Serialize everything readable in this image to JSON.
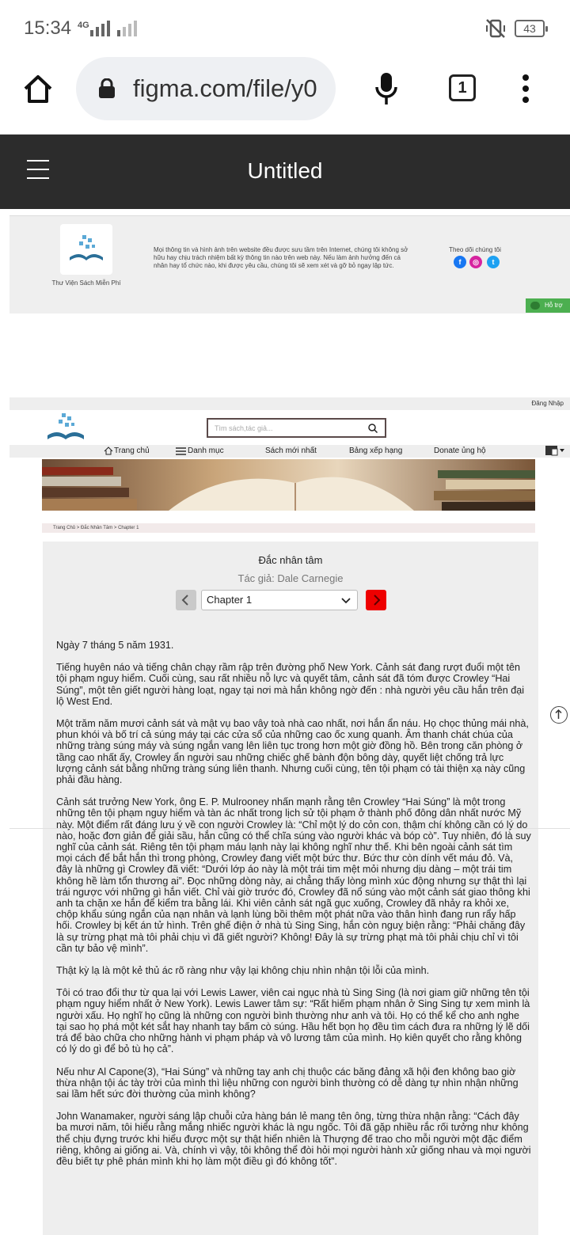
{
  "status_bar": {
    "time": "15:34",
    "network": "4G",
    "battery": "43"
  },
  "browser": {
    "url": "figma.com/file/y0",
    "tab_count": "1",
    "icons": [
      "home-icon",
      "lock-icon",
      "mic-icon",
      "tabs-icon",
      "more-vert-icon"
    ]
  },
  "figma": {
    "title": "Untitled"
  },
  "footer": {
    "site_name": "Thư Viện Sách Miễn Phí",
    "disclaimer": "Mọi thông tin và hình ảnh trên website đều được sưu tầm trên Internet, chúng tôi không sở hữu hay chịu trách nhiệm bất kỳ thông tin nào trên web này. Nếu làm ảnh hưởng đến cá nhân hay tổ chức nào, khi được yêu cầu, chúng tôi sẽ xem xét và gỡ bỏ ngay lập tức.",
    "follow_label": "Theo dõi chúng tôi",
    "support_label": "Hỗ trợ",
    "social_colors": {
      "facebook": "#1877f2",
      "instagram": "#d6249f",
      "twitter": "#1da1f2"
    }
  },
  "site": {
    "login": "Đăng Nhập",
    "search_placeholder": "Tìm sách,tác giả...",
    "nav": {
      "home": "Trang chủ",
      "catalog": "Danh mục",
      "new": "Sách mới nhất",
      "ranking": "Bảng xếp hạng",
      "donate": "Donate ủng hộ"
    },
    "breadcrumb": [
      "Trang Chủ",
      "Đắc Nhân Tâm",
      "Chapter 1"
    ]
  },
  "reader": {
    "book_title": "Đắc nhân tâm",
    "author": "Tác giả: Dale Carnegie",
    "chapter": "Chapter 1",
    "next_color": "#ee0000",
    "paragraphs": [
      "Ngày 7 tháng 5 năm 1931.",
      "Tiếng huyên náo và tiếng chân chạy rầm rập trên đường phố New York. Cảnh sát đang rượt đuổi một tên tội phạm nguy hiểm. Cuối cùng, sau rất nhiều nỗ lực và quyết tâm, cảnh sát đã tóm được Crowley “Hai Súng”, một tên giết người hàng loạt, ngay tại nơi mà hắn không ngờ đến : nhà người yêu cầu hắn trên đại lộ West End.",
      "Một trăm năm mươi cảnh sát và mật vụ bao vây toà nhà cao nhất, nơi hắn ẩn náu. Họ chọc thủng mái nhà, phun khói và bố trí cả súng máy tại các cửa sổ của những cao ốc xung quanh. Âm thanh chát chúa của những tràng súng máy và súng ngắn vang lên liên tục trong hơn một giờ đồng hồ. Bên trong căn phòng ở tầng cao nhất ấy, Crowley ẩn người sau những chiếc ghế bành độn bông dày, quyết liệt chống trả lực lượng cảnh sát bằng những tràng súng liên thanh. Nhưng cuối cùng, tên tội phạm có tài thiện xạ này cũng phải đầu hàng.",
      "Cảnh sát trưởng New York, ông E. P. Mulrooney nhấn mạnh rằng tên Crowley “Hai Súng” là một trong những tên tội phạm nguy hiểm và tàn ác nhất trong lịch sử tội phạm ở thành phố đông dân nhất nước Mỹ này. Một điểm rất đáng lưu ý về con người Crowley là: “Chỉ một lý do cỏn con, thậm chí không cần có lý do nào, hoặc đơn giản để giải sầu, hắn cũng có thể chĩa súng vào người khác và bóp cò”. Tuy nhiên, đó là suy nghĩ của cảnh sát. Riêng tên tội phạm máu lạnh này lại không nghĩ như thế. Khi bên ngoài cảnh sát tìm mọi cách để bắt hắn thì trong phòng, Crowley đang viết một bức thư. Bức thư còn dính vết máu đỏ. Và, đây là những gì Crowley đã viết: “Dưới lớp áo này là một trái tim mệt mỏi nhưng dịu dàng – một trái tim không hề làm tổn thương ai”. Đọc những dòng này, ai chẳng thấy lòng mình xúc động nhưng sự thật thì lại trái ngược với những gì hắn viết. Chỉ vài giờ trước đó, Crowley đã nổ súng vào một cảnh sát giao thông khi anh ta chặn xe hắn để kiểm tra bằng lái. Khi viên cảnh sát ngã gục xuống, Crowley đã nhảy ra khỏi xe, chộp khẩu súng ngắn của nạn nhân và lạnh lùng bồi thêm một phát nữa vào thân hình đang run rẩy hấp hối. Crowley bị kết án tử hình. Trên ghế điện ở nhà tù Sing Sing, hắn còn nguỵ biện rằng: “Phải chăng đây là sự trừng phạt mà tôi phải chịu vì đã giết người? Không! Đây là sự trừng phạt mà tôi phải chịu chỉ vì tôi cần tự bảo vệ mình”.",
      "Thật kỳ lạ là một kẻ thủ ác rõ ràng như vậy lại không chịu nhìn nhận tội lỗi của mình.",
      "Tôi có trao đổi thư từ qua lại với Lewis Lawer, viên cai ngục nhà tù Sing Sing (là nơi giam giữ những tên tội phạm nguy hiểm nhất ở New York). Lewis Lawer tâm sự: “Rất hiếm phạm nhân ở Sing Sing tự xem mình là người xấu. Họ nghĩ họ cũng là những con người bình thường như anh và tôi. Họ có thể kể cho anh nghe tại sao họ phá một két sắt hay nhanh tay bấm cò súng. Hầu hết bọn họ đều tìm cách đưa ra những lý lẽ dối trá để bào chữa cho những hành vi phạm pháp và vô lương tâm của mình. Họ kiên quyết cho rằng không có lý do gì để bỏ tù họ cả”.",
      "Nếu như Al Capone(3), “Hai Súng” và những tay anh chị thuộc các băng đảng xã hội đen không bao giờ thừa nhận tội ác tày trời của mình thì liệu những con người bình thường có dễ dàng tự nhìn nhận những sai lầm hết sức đời thường của mình không?",
      "John Wanamaker, người sáng lập chuỗi cửa hàng bán lẻ mang tên ông, từng thừa nhận rằng: “Cách đây ba mươi năm, tôi hiểu rằng mắng nhiếc người khác là ngu ngốc. Tôi đã gặp nhiều rắc rối tưởng như không thể chịu đựng trước khi hiểu được một sự thật hiển nhiên là Thượng đế trao cho mỗi người một đặc điểm riêng, không ai giống ai. Và, chính vì vậy, tôi không thể đòi hỏi mọi người hành xử giống nhau và mọi người đều biết tự phê phán mình khi họ làm một điều gì đó không tốt”."
    ]
  }
}
